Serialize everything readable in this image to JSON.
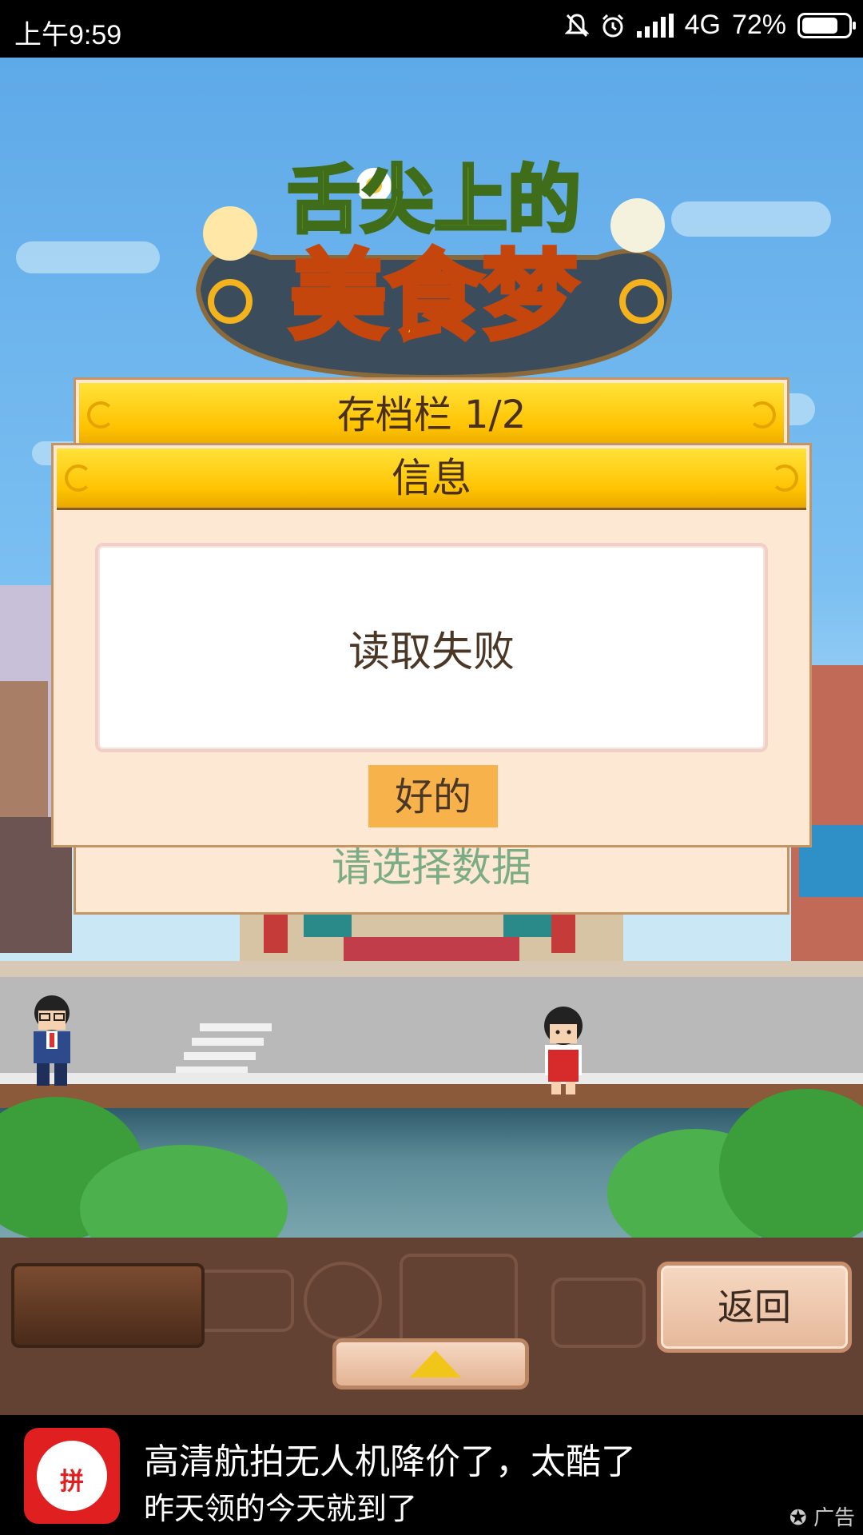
{
  "status_bar": {
    "time": "上午9:59",
    "network": "4G",
    "battery": "72%",
    "battery_level": 0.72
  },
  "game": {
    "logo_top": "舌尖上的",
    "logo_bottom": "美食梦"
  },
  "save_panel": {
    "title": "存档栏 1/2",
    "prompt": "请选择数据"
  },
  "dialog": {
    "title": "信息",
    "message": "读取失败",
    "ok_label": "好的"
  },
  "bottom_bar": {
    "back_label": "返回"
  },
  "ad": {
    "title": "高清航拍无人机降价了，太酷了",
    "subtitle": "昨天领的今天就到了",
    "tag": "广告",
    "app_icon": "pinduoduo-icon"
  }
}
